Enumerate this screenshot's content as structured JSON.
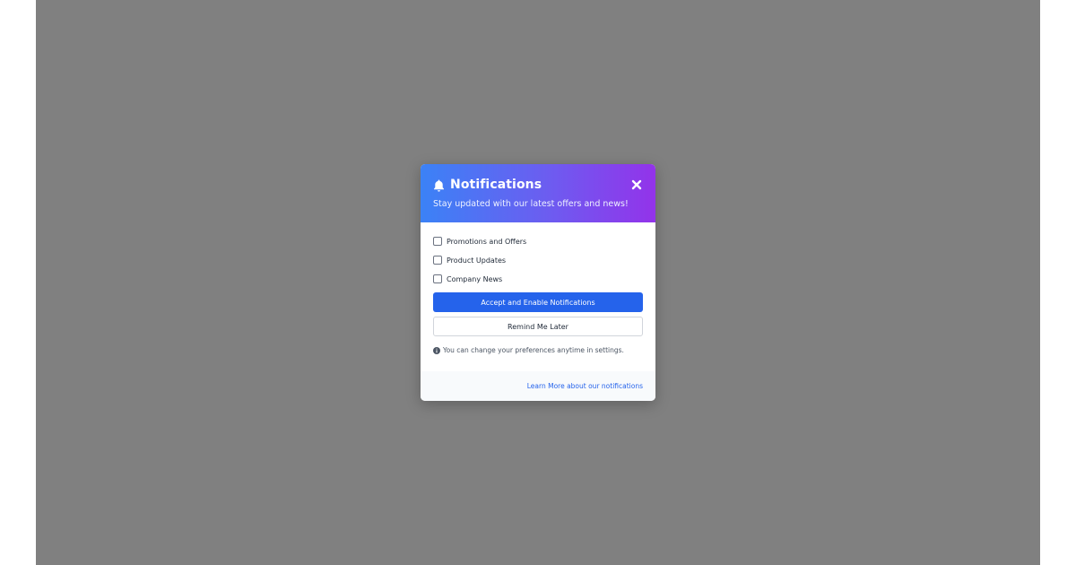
{
  "modal": {
    "title": "Notifications",
    "subtitle": "Stay updated with our latest offers and news!",
    "close_icon": "close-icon",
    "header_icon": "bell-icon",
    "options": [
      {
        "label": "Promotions and Offers",
        "checked": false
      },
      {
        "label": "Product Updates",
        "checked": false
      },
      {
        "label": "Company News",
        "checked": false
      }
    ],
    "accept_label": "Accept and Enable Notifications",
    "remind_label": "Remind Me Later",
    "note": "You can change your preferences anytime in settings.",
    "learn_more": "Learn More about our notifications"
  },
  "colors": {
    "overlay": "#808080",
    "gradient_start": "#3b82f6",
    "gradient_end": "#9333ea",
    "primary": "#2563eb"
  }
}
